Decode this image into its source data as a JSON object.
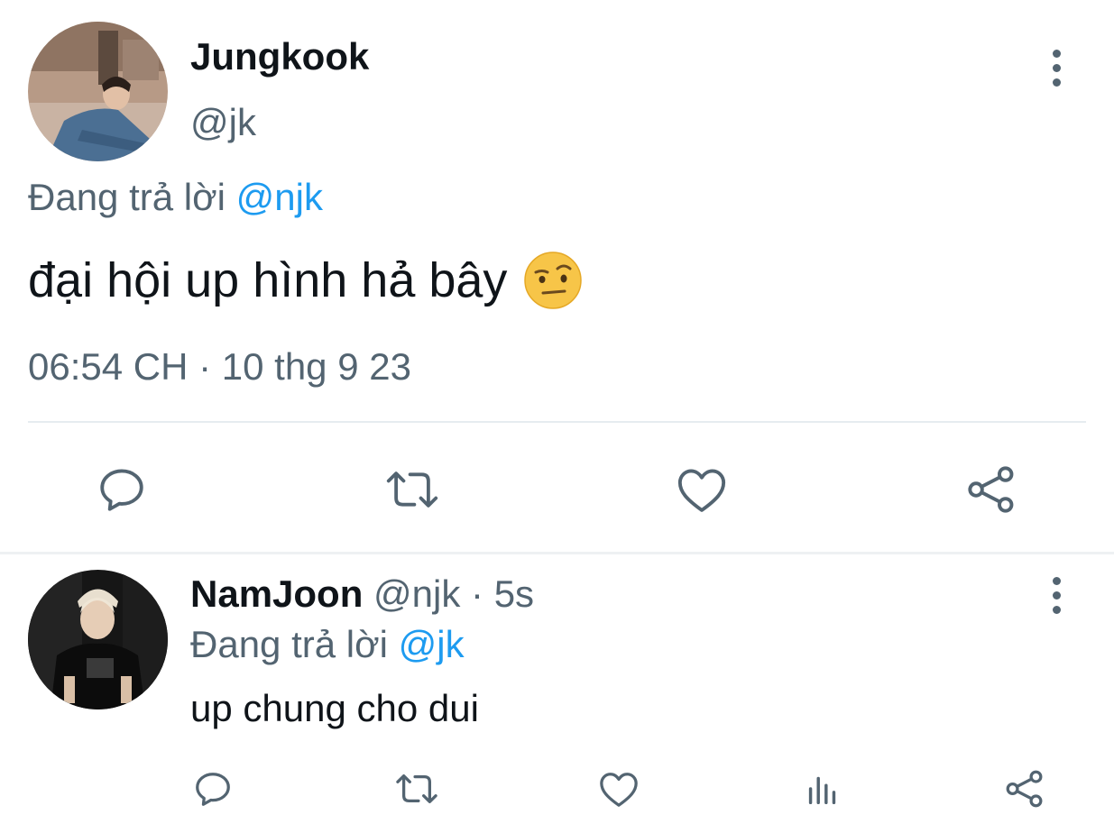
{
  "main_tweet": {
    "display_name": "Jungkook",
    "handle": "@jk",
    "reply_prefix": "Đang trả lời",
    "reply_mention": "@njk",
    "text": "đại hội up hình hả bây",
    "emoji": "face-with-raised-eyebrow",
    "timestamp": "06:54 CH · 10 thg 9 23",
    "actions": [
      "reply-icon",
      "retweet-icon",
      "like-icon",
      "share-icon"
    ]
  },
  "reply_tweet": {
    "display_name": "NamJoon",
    "handle": "@njk",
    "separator": "·",
    "time_ago": "5s",
    "reply_prefix": "Đang trả lời",
    "reply_mention": "@jk",
    "text": "up chung cho dui",
    "actions": [
      "reply-icon",
      "retweet-icon",
      "like-icon",
      "analytics-icon",
      "share-icon"
    ]
  },
  "colors": {
    "text_primary": "#0f1419",
    "text_secondary": "#536471",
    "link": "#1d9bf0",
    "divider": "#e6ecf0"
  }
}
